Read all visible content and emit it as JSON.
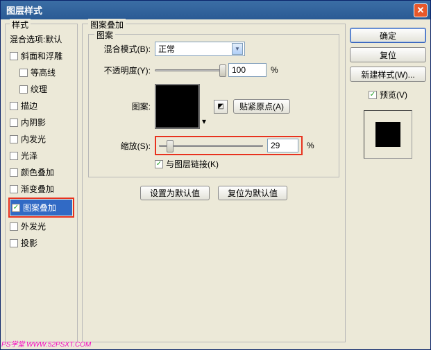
{
  "title": "图层样式",
  "sidebar": {
    "group_label": "样式",
    "header": "混合选项:默认",
    "items": [
      {
        "label": "斜面和浮雕",
        "checked": false,
        "selected": false,
        "indent": false
      },
      {
        "label": "等高线",
        "checked": false,
        "selected": false,
        "indent": true
      },
      {
        "label": "纹理",
        "checked": false,
        "selected": false,
        "indent": true
      },
      {
        "label": "描边",
        "checked": false,
        "selected": false,
        "indent": false
      },
      {
        "label": "内阴影",
        "checked": false,
        "selected": false,
        "indent": false
      },
      {
        "label": "内发光",
        "checked": false,
        "selected": false,
        "indent": false
      },
      {
        "label": "光泽",
        "checked": false,
        "selected": false,
        "indent": false
      },
      {
        "label": "颜色叠加",
        "checked": false,
        "selected": false,
        "indent": false
      },
      {
        "label": "渐变叠加",
        "checked": false,
        "selected": false,
        "indent": false
      },
      {
        "label": "图案叠加",
        "checked": true,
        "selected": true,
        "indent": false,
        "highlight": true
      },
      {
        "label": "外发光",
        "checked": false,
        "selected": false,
        "indent": false
      },
      {
        "label": "投影",
        "checked": false,
        "selected": false,
        "indent": false
      }
    ]
  },
  "main": {
    "group_label": "图案叠加",
    "inner_label": "图案",
    "blend_mode_label": "混合模式(B):",
    "blend_mode_value": "正常",
    "opacity_label": "不透明度(Y):",
    "opacity_value": "100",
    "opacity_unit": "%",
    "pattern_label": "图案:",
    "snap_button": "贴紧原点(A)",
    "scale_label": "缩放(S):",
    "scale_value": "29",
    "scale_unit": "%",
    "link_label": "与图层链接(K)",
    "link_checked": true,
    "set_default": "设置为默认值",
    "reset_default": "复位为默认值"
  },
  "right": {
    "ok": "确定",
    "cancel": "复位",
    "new_style": "新建样式(W)...",
    "preview": "预览(V)",
    "preview_checked": true
  },
  "watermark": "PS学堂  WWW.52PSXT.COM"
}
